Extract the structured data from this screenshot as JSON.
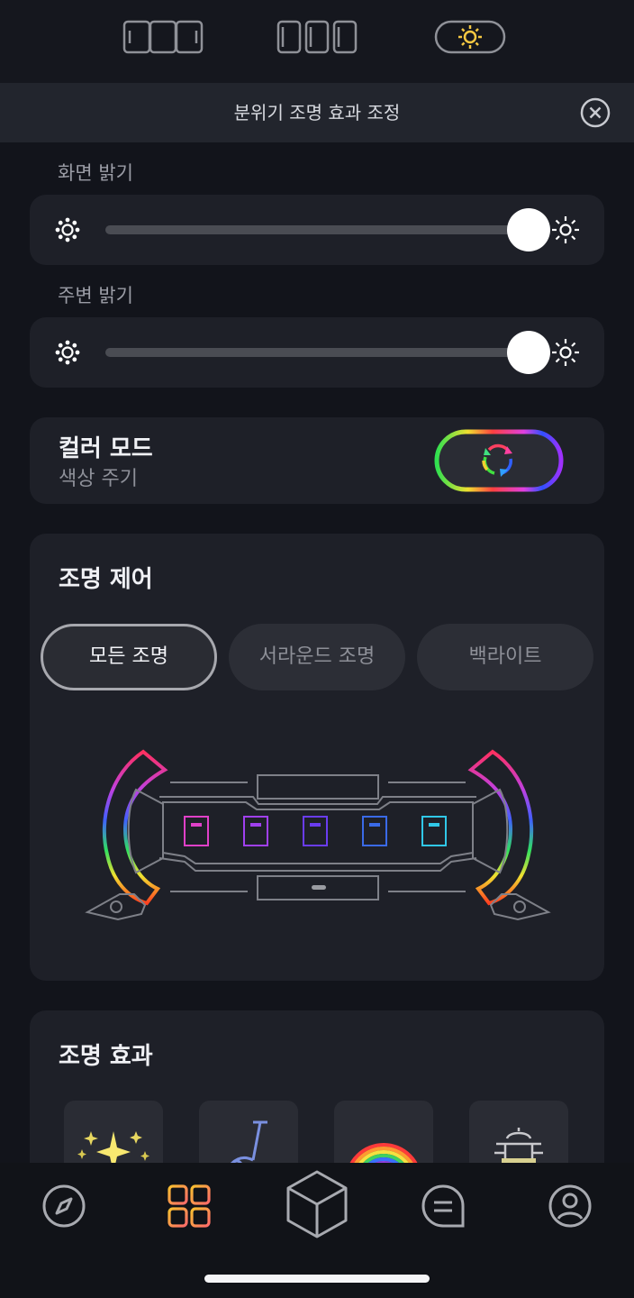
{
  "header": {
    "title": "분위기 조명 효과 조정"
  },
  "screen_brightness": {
    "label": "화면 밝기",
    "value_percent": 100
  },
  "ambient_brightness": {
    "label": "주변 밝기",
    "value_percent": 100
  },
  "color_mode": {
    "title": "컬러 모드",
    "subtitle": "색상 주기"
  },
  "lighting_control": {
    "title": "조명 제어",
    "tabs": [
      {
        "label": "모든 조명",
        "active": true
      },
      {
        "label": "서라운드 조명",
        "active": false
      },
      {
        "label": "백라이트",
        "active": false
      }
    ],
    "button_colors": [
      "#e040c8",
      "#a040f0",
      "#6a3cf0",
      "#3a6ae8",
      "#30c8e8"
    ]
  },
  "lighting_effects": {
    "title": "조명 효과"
  },
  "icons": {
    "top": [
      "ring-layout-wide-icon",
      "ring-layout-buttons-icon",
      "brightness-pill-icon"
    ],
    "nav": [
      "compass-icon",
      "grid-icon",
      "cube-icon",
      "chat-icon",
      "profile-icon"
    ]
  },
  "colors": {
    "accent": "#f0a830",
    "background": "#12141b",
    "card": "#1e2028"
  }
}
